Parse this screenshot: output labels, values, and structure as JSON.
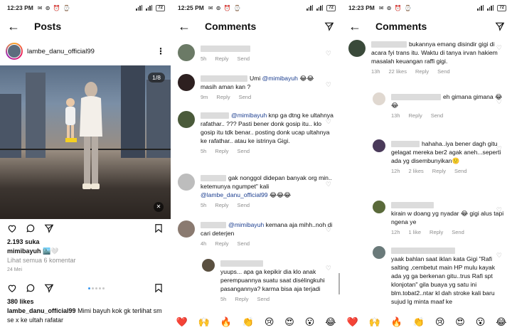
{
  "posts": {
    "time": "12:23 PM",
    "battery": "72",
    "title": "Posts",
    "username": "lambe_danu_official99",
    "counter": "1/8",
    "likes": "2.193 suka",
    "caption_user": "mimibayuh",
    "caption_text": "🏙️🤍",
    "view_comments": "Lihat semua 6 komentar",
    "date": "24 Mei",
    "post2_likes": "380 likes",
    "post2_user": "lambe_danu_official99",
    "post2_text": "Mimi bayuh kok gk terlihat sm se x ke ultah rafatar"
  },
  "comments_mid": {
    "time": "12:25 PM",
    "battery": "72",
    "title": "Comments",
    "items": [
      {
        "text": "",
        "time": "5h",
        "reply": "Reply",
        "send": "Send"
      },
      {
        "mention": "@mimibayuh",
        "text": "masih aman kan ?",
        "pre": "Umi",
        "emoji": "😂😂",
        "time": "9m",
        "reply": "Reply",
        "send": "Send"
      },
      {
        "mention": "@mimibayuh",
        "text": "knp ga dtng ke ultahnya rafathar.. ??? Pasti bener donk gosip itu.. klo gosip itu tdk benar.. posting donk ucap ultahnya ke rafathar.. atau ke istrinya Gigi.",
        "time": "5h",
        "reply": "Reply",
        "send": "Send"
      },
      {
        "text": "gak nonggol didepan banyak org min.. ketemunya ngumpet\" kali",
        "mention": "@lambe_danu_official99",
        "emoji": "😂😂😂",
        "time": "5h",
        "reply": "Reply",
        "send": "Send"
      },
      {
        "mention": "@mimibayuh",
        "text": "kemana aja mihh..noh di cari deterjen",
        "time": "4h",
        "reply": "Reply",
        "send": "Send"
      },
      {
        "text": "yuups... apa ga kepikir dia klo anak perempuannya suatu saat disélingkuhi pasangannya? karma bisa aja terjadi",
        "time": "5h",
        "reply": "Reply",
        "send": "Send"
      }
    ],
    "emojis": [
      "❤️",
      "🙌",
      "🔥",
      "👏",
      "😢",
      "😍",
      "😮",
      "😂"
    ]
  },
  "comments_right": {
    "time": "12:23 PM",
    "battery": "72",
    "title": "Comments",
    "items": [
      {
        "text": "bukannya emang disindir gigi di acara fyi trans itu. Waktu di tanya irvan hakiem masalah keuangan raffi gigi.",
        "time": "13h",
        "likes": "22 likes",
        "reply": "Reply",
        "send": "Send"
      },
      {
        "text": "eh gimana gimana",
        "emoji": "😂😂",
        "time": "13h",
        "reply": "Reply",
        "send": "Send"
      },
      {
        "text": "hahaha..iya bener dagh gitu gelagat mereka ber2 agak aneh...seperti ada yg disembunyikan",
        "emoji": "🙂",
        "time": "12h",
        "likes": "2 likes",
        "reply": "Reply",
        "send": "Send"
      },
      {
        "text": "kirain w doang yg nyadar",
        "emoji": "😂",
        "text2": "gigi alus tapi ngena ye",
        "time": "12h",
        "likes": "1 like",
        "reply": "Reply",
        "send": "Send"
      },
      {
        "text": "yaak bahlan saat iklan kata Gigi \"Rafi salting ,cembetut main HP mulu kayak ada yg ga berkenan gitu..trus Rafi spt klonjotan\" gila buaya yg satu ini blm.tobat2..ntar kl dah stroke kali baru sujud lg minta maaf ke"
      }
    ],
    "emojis": [
      "❤️",
      "🙌",
      "🔥",
      "👏",
      "😢",
      "😍",
      "😮",
      "😂"
    ]
  }
}
